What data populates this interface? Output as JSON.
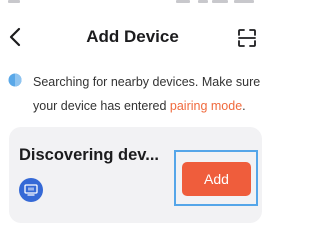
{
  "header": {
    "title": "Add Device",
    "back_icon": "chevron-left-icon",
    "scan_icon": "scan-icon"
  },
  "info": {
    "icon": "info-dot-icon",
    "text": "Searching for nearby devices. Make sure your device has entered ",
    "link_text": "pairing mode",
    "suffix": "."
  },
  "card": {
    "title": "Discovering dev...",
    "device_icon": "device-icon",
    "add_label": "Add"
  },
  "colors": {
    "accent": "#ef5d3c",
    "link": "#f06a3d",
    "device_icon_bg": "#3569d6",
    "info_icon": "#5aa8e8",
    "focus_outline": "#55a6e9",
    "card_bg": "#f2f2f4"
  }
}
